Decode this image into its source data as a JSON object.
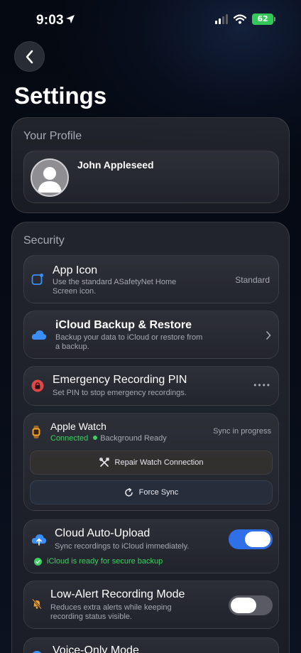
{
  "status_bar": {
    "time": "9:03",
    "battery": "62"
  },
  "page": {
    "title": "Settings"
  },
  "profile": {
    "heading": "Your Profile",
    "name": "John  Appleseed"
  },
  "security": {
    "heading": "Security",
    "app_icon": {
      "title": "App Icon",
      "subtitle_1": "Use the standard ASafetyNet Home",
      "subtitle_2": "Screen icon.",
      "value": "Standard"
    },
    "icloud_backup": {
      "title": "iCloud Backup & Restore",
      "subtitle_1": "Backup your data to iCloud or restore from",
      "subtitle_2": "a backup."
    },
    "emergency_pin": {
      "title": "Emergency Recording PIN",
      "subtitle": "Set PIN to stop emergency recordings.",
      "value": "••••"
    },
    "apple_watch": {
      "title": "Apple Watch",
      "connected": "Connected",
      "background": "Background Ready",
      "status": "Sync in progress",
      "repair_label": "Repair Watch Connection",
      "sync_label": "Force Sync"
    },
    "cloud_upload": {
      "title": "Cloud Auto-Upload",
      "subtitle": "Sync recordings to iCloud immediately.",
      "ready": "iCloud is ready for secure backup",
      "enabled": true
    },
    "low_alert": {
      "title": "Low-Alert Recording Mode",
      "subtitle_1": "Reduces extra alerts while keeping",
      "subtitle_2": "recording status visible.",
      "enabled": false
    },
    "voice_only": {
      "title": "Voice-Only Mode"
    }
  },
  "icons": [
    "location-arrow-icon",
    "signal-icon",
    "wifi-icon",
    "battery-icon",
    "chevron-left-icon",
    "person-icon",
    "app-icon-square",
    "cloud-icon",
    "chevron-right-icon",
    "lock-icon",
    "watch-icon",
    "tools-icon",
    "refresh-icon",
    "cloud-upload-icon",
    "checkmark-circle-icon",
    "muted-bell-icon"
  ],
  "colors": {
    "accent": "#2f6fe8",
    "success": "#3ccf5f",
    "danger": "#e04848",
    "watch": "#f0a030"
  }
}
